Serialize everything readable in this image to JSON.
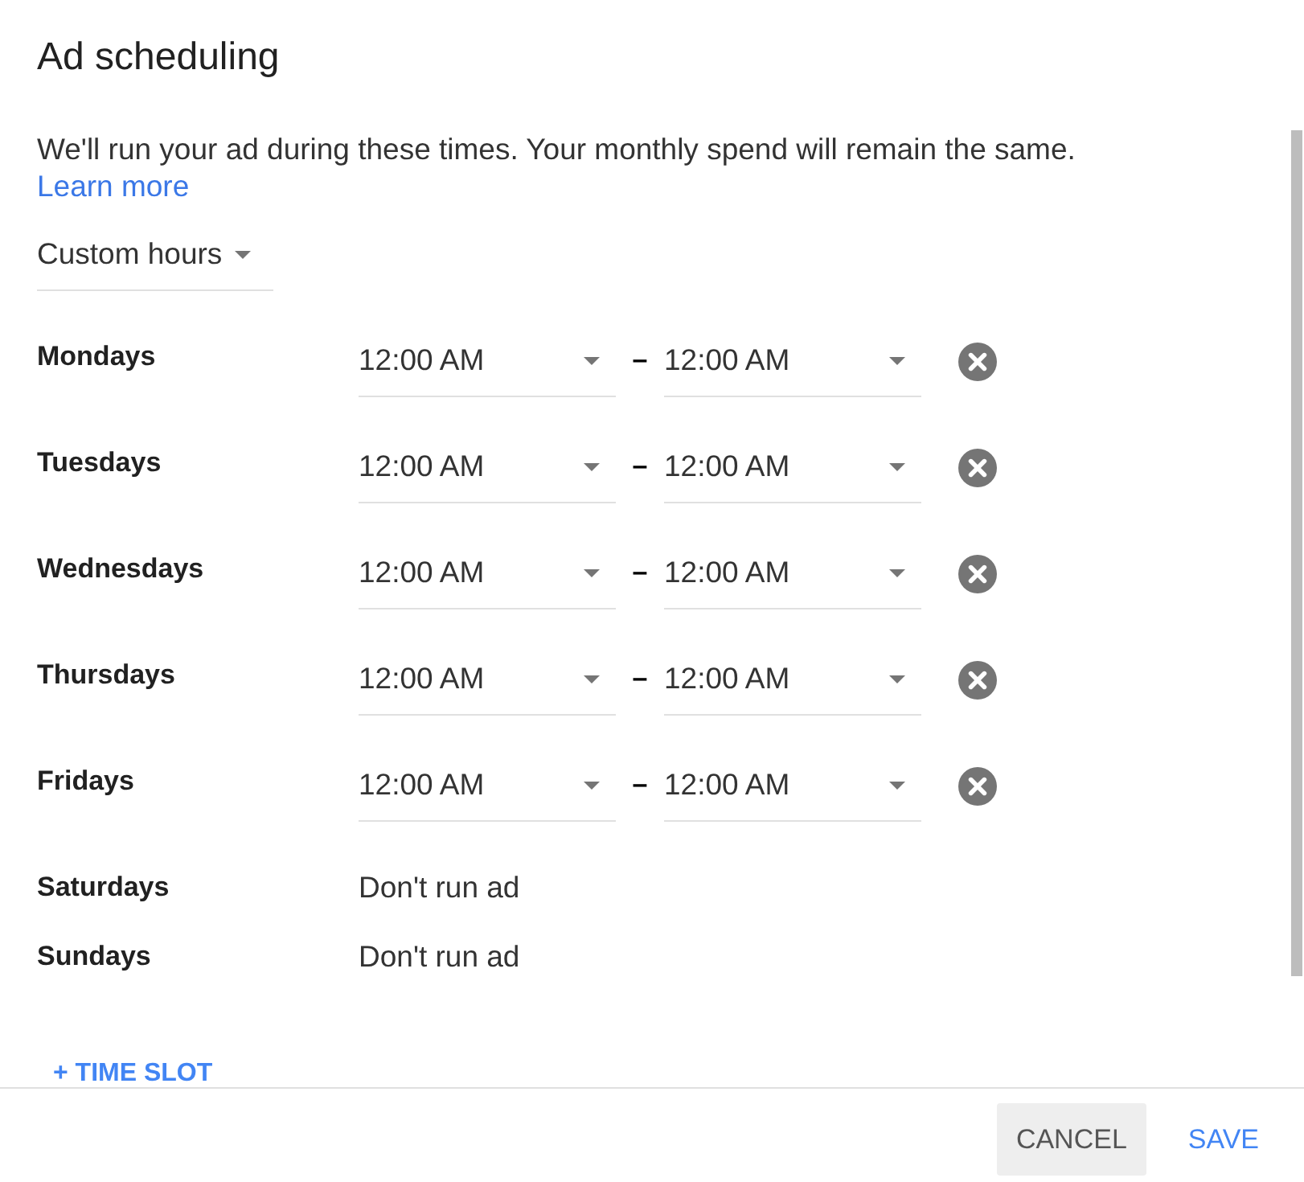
{
  "dialog": {
    "title": "Ad scheduling"
  },
  "description": {
    "text": "We'll run your ad during these times. Your monthly spend will remain the same.",
    "link": "Learn more"
  },
  "schedule_type": {
    "value": "Custom hours"
  },
  "days": [
    {
      "kind": "slot",
      "day": "Mondays",
      "start": "12:00 AM",
      "separator": "–",
      "end": "12:00 AM"
    },
    {
      "kind": "slot",
      "day": "Tuesdays",
      "start": "12:00 AM",
      "separator": "–",
      "end": "12:00 AM"
    },
    {
      "kind": "slot",
      "day": "Wednesdays",
      "start": "12:00 AM",
      "separator": "–",
      "end": "12:00 AM"
    },
    {
      "kind": "slot",
      "day": "Thursdays",
      "start": "12:00 AM",
      "separator": "–",
      "end": "12:00 AM"
    },
    {
      "kind": "slot",
      "day": "Fridays",
      "start": "12:00 AM",
      "separator": "–",
      "end": "12:00 AM"
    },
    {
      "kind": "off",
      "day": "Saturdays",
      "status": "Don't run ad"
    },
    {
      "kind": "off",
      "day": "Sundays",
      "status": "Don't run ad"
    }
  ],
  "add_time_slot": {
    "label": "+ TIME SLOT"
  },
  "buttons": [
    {
      "kind": "secondary",
      "label": "CANCEL"
    },
    {
      "kind": "primary",
      "label": "SAVE"
    }
  ]
}
